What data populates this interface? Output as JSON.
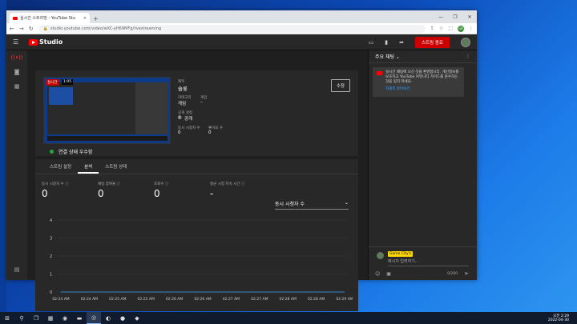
{
  "browser": {
    "tab_title": "실시간 스트리밍 - YouTube Stu",
    "tab_close": "×",
    "new_tab": "+",
    "url": "studio.youtube.com/video/wXC-yH69MFg/livestreaming",
    "win_min": "—",
    "win_max": "❐",
    "win_close": "✕",
    "profile_initial": "GK"
  },
  "studio": {
    "logo_text": "Studio",
    "end_stream_label": "스트림 종료"
  },
  "stream": {
    "live_badge": "실시간",
    "live_time": "1:05",
    "connection_status": "연결 상태 우수함",
    "edit_label": "수정",
    "title_label": "제목",
    "title_value": "슬롯",
    "category_label": "카테고리",
    "category_value": "게임",
    "game_label": "게임",
    "game_value": "–",
    "privacy_label": "공개 설정",
    "privacy_value": "공개",
    "viewers_label": "동시 시청자 수",
    "viewers_value": "0",
    "likes_label": "좋아요 수",
    "likes_value": "0"
  },
  "analytics": {
    "tabs": [
      {
        "label": "스트림 설정"
      },
      {
        "label": "분석"
      },
      {
        "label": "스트림 상태"
      }
    ],
    "stats": [
      {
        "label": "동시 시청자 수",
        "value": "0"
      },
      {
        "label": "채팅 참여율",
        "value": "0"
      },
      {
        "label": "조회수",
        "value": "0"
      },
      {
        "label": "평균 시청 지속 시간",
        "value": "-"
      }
    ],
    "metric_selector": "동시 시청자 수"
  },
  "chart_data": {
    "type": "line",
    "title": "",
    "xlabel": "",
    "ylabel": "",
    "y_ticks": [
      0,
      1,
      2,
      3,
      4
    ],
    "ylim": [
      0,
      4
    ],
    "x": [
      "02:24 AM",
      "02:24 AM",
      "02:25 AM",
      "02:25 AM",
      "02:26 AM",
      "02:26 AM",
      "02:27 AM",
      "02:27 AM",
      "02:28 AM",
      "02:28 AM",
      "02:29 AM"
    ],
    "series": [
      {
        "values": [
          0,
          0,
          0,
          0,
          0,
          0,
          0,
          0,
          0,
          0,
          0
        ]
      }
    ],
    "grid": true,
    "colors": {
      "grid": "#3a3a3a",
      "line": "#3ea6ff"
    }
  },
  "chat": {
    "header_label": "주요 채팅",
    "notice_text": "실시간 채팅에 오신 것을 환영합니다. 개인정보를 보호하고 YouTube 커뮤니티 가이드를 준수하는 것을 잊지 마세요.",
    "notice_link": "자세히 알아보기",
    "user_name": "Game City's",
    "input_placeholder": "메시지 입력하기...",
    "char_count": "0/200"
  },
  "taskbar": {
    "time": "오전 2:29",
    "date": "2022-04-30"
  }
}
